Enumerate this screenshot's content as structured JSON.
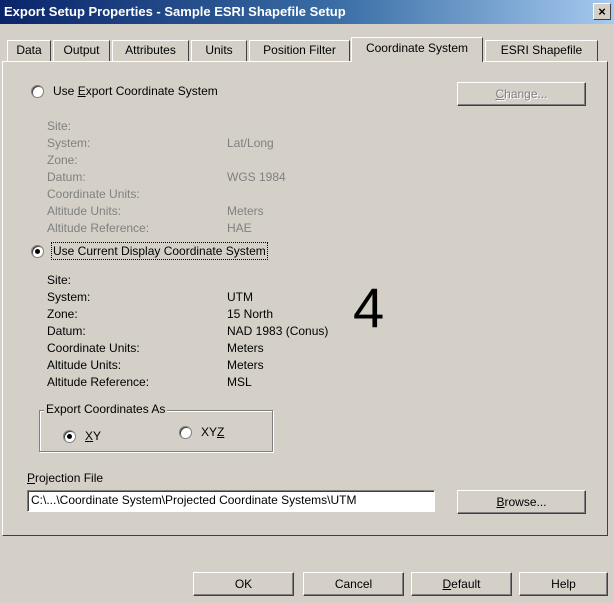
{
  "window": {
    "title": "Export Setup Properties - Sample ESRI Shapefile Setup",
    "close_glyph": "×"
  },
  "tabs": [
    {
      "label": "Data"
    },
    {
      "label": "Output"
    },
    {
      "label": "Attributes"
    },
    {
      "label": "Units"
    },
    {
      "label": "Position Filter"
    },
    {
      "label": "Coordinate System",
      "active": true
    },
    {
      "label": "ESRI Shapefile"
    }
  ],
  "export_cs": {
    "radio_label_pre": "Use ",
    "radio_label_accel": "E",
    "radio_label_post": "xport Coordinate System",
    "selected": false,
    "change_button": {
      "accel": "C",
      "rest": "hange...",
      "enabled": false
    },
    "fields": [
      {
        "label": "Site:",
        "value": ""
      },
      {
        "label": "System:",
        "value": "Lat/Long"
      },
      {
        "label": "Zone:",
        "value": ""
      },
      {
        "label": "Datum:",
        "value": "WGS 1984"
      },
      {
        "label": "Coordinate Units:",
        "value": ""
      },
      {
        "label": "Altitude Units:",
        "value": "Meters"
      },
      {
        "label": "Altitude Reference:",
        "value": "HAE"
      }
    ]
  },
  "display_cs": {
    "radio_label": "Use Current Display Coordinate System",
    "selected": true,
    "fields": [
      {
        "label": "Site:",
        "value": ""
      },
      {
        "label": "System:",
        "value": "UTM"
      },
      {
        "label": "Zone:",
        "value": "15 North"
      },
      {
        "label": "Datum:",
        "value": "NAD 1983 (Conus)"
      },
      {
        "label": "Coordinate Units:",
        "value": "Meters"
      },
      {
        "label": "Altitude Units:",
        "value": "Meters"
      },
      {
        "label": "Altitude Reference:",
        "value": "MSL"
      }
    ]
  },
  "annotation_number": "4",
  "export_coords": {
    "title": "Export Coordinates As",
    "xy": {
      "accel": "X",
      "rest": "Y",
      "selected": true
    },
    "xyz": {
      "pre": "XY",
      "accel": "Z",
      "selected": false
    }
  },
  "projection": {
    "label_accel": "P",
    "label_rest": "rojection File",
    "value": "C:\\...\\Coordinate System\\Projected Coordinate Systems\\UTM",
    "browse": {
      "accel": "B",
      "rest": "rowse..."
    }
  },
  "footer": {
    "ok": "OK",
    "cancel": "Cancel",
    "default_accel": "D",
    "default_rest": "efault",
    "help": "Help"
  }
}
